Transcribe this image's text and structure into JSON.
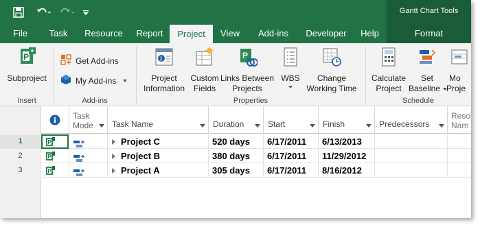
{
  "titlebar": {
    "context_title": "Gantt Chart Tools",
    "qat": [
      {
        "icon": "save-icon"
      },
      {
        "icon": "undo-icon"
      },
      {
        "icon": "redo-icon"
      },
      {
        "icon": "customize-qat-icon"
      }
    ]
  },
  "tabs": [
    {
      "label": "File"
    },
    {
      "label": "Task"
    },
    {
      "label": "Resource"
    },
    {
      "label": "Report"
    },
    {
      "label": "Project",
      "active": true
    },
    {
      "label": "View"
    },
    {
      "label": "Add-ins"
    },
    {
      "label": "Developer"
    },
    {
      "label": "Help"
    },
    {
      "label": "Format",
      "context": true
    }
  ],
  "ribbon": {
    "groups": {
      "insert": {
        "label": "Insert",
        "subproject": "Subproject"
      },
      "addins": {
        "label": "Add-ins",
        "get_addins": "Get Add-ins",
        "my_addins": "My Add-ins"
      },
      "properties": {
        "label": "Properties",
        "project_information": [
          "Project",
          "Information"
        ],
        "custom_fields": [
          "Custom",
          "Fields"
        ],
        "links_between_projects": [
          "Links Between",
          "Projects"
        ],
        "wbs": "WBS",
        "change_working_time": [
          "Change",
          "Working Time"
        ]
      },
      "schedule": {
        "label": "Schedule",
        "calculate_project": [
          "Calculate",
          "Project"
        ],
        "set_baseline": [
          "Set",
          "Baseline"
        ],
        "move_project": [
          "Mo",
          "Proje"
        ]
      }
    }
  },
  "grid": {
    "headers": {
      "info_icon": "info-icon",
      "task_mode": [
        "Task",
        "Mode"
      ],
      "task_name": "Task Name",
      "duration": "Duration",
      "start": "Start",
      "finish": "Finish",
      "predecessors": "Predecessors",
      "resource_names": [
        "Reso",
        "Nam"
      ]
    },
    "rows": [
      {
        "num": "1",
        "name": "Project C",
        "duration": "520 days",
        "start": "6/17/2011",
        "finish": "6/13/2013"
      },
      {
        "num": "2",
        "name": "Project B",
        "duration": "380 days",
        "start": "6/17/2011",
        "finish": "11/29/2012"
      },
      {
        "num": "3",
        "name": "Project A",
        "duration": "305 days",
        "start": "6/17/2011",
        "finish": "8/16/2012"
      }
    ]
  },
  "colors": {
    "brand": "#217346",
    "brand_dark": "#1a5c38",
    "ribbon_bg": "#f3f3f3"
  }
}
